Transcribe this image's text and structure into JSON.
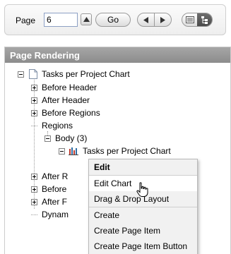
{
  "toolbar": {
    "page_label": "Page",
    "page_value": "6",
    "go_label": "Go",
    "icons": {
      "page_up": "arrow-up-icon",
      "prev": "triangle-left-icon",
      "next": "triangle-right-icon",
      "list_view": "list-view-icon",
      "tree_view": "tree-view-icon"
    },
    "active_view": "tree"
  },
  "panel": {
    "title": "Page Rendering"
  },
  "tree": {
    "root": "Tasks per Project Chart",
    "items": [
      {
        "label": "Before Header",
        "state": "collapsed"
      },
      {
        "label": "After Header",
        "state": "collapsed"
      },
      {
        "label": "Before Regions",
        "state": "collapsed"
      },
      {
        "label": "Regions",
        "state": "expanded"
      }
    ],
    "body_label": "Body (3)",
    "chart_label": "Tasks per Project Chart",
    "partial_items": [
      "After R",
      "Before",
      "After F",
      "Dynam"
    ]
  },
  "context_menu": {
    "items": [
      "Edit",
      "Edit Chart",
      "Drag & Drop Layout",
      "Create",
      "Create Page Item",
      "Create Page Item Button"
    ],
    "hovered": "Edit Chart"
  },
  "colors": {
    "panel_header": "#999999",
    "input_border": "#8da0c4",
    "menu_bg": "#f1f1f1"
  }
}
